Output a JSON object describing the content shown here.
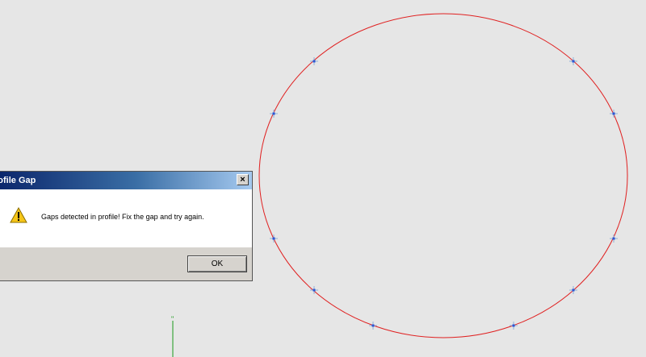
{
  "dialog": {
    "title": "rofile Gap",
    "message": "Gaps detected in profile! Fix the gap and try again.",
    "ok_label": "OK",
    "close_glyph": "×",
    "icon": "warning-icon"
  },
  "canvas": {
    "background": "#e6e6e6",
    "curve_color": "#e02020",
    "point_color": "#2a56d6",
    "line_color": "#1a9a1a",
    "line_label": "ʺ"
  }
}
